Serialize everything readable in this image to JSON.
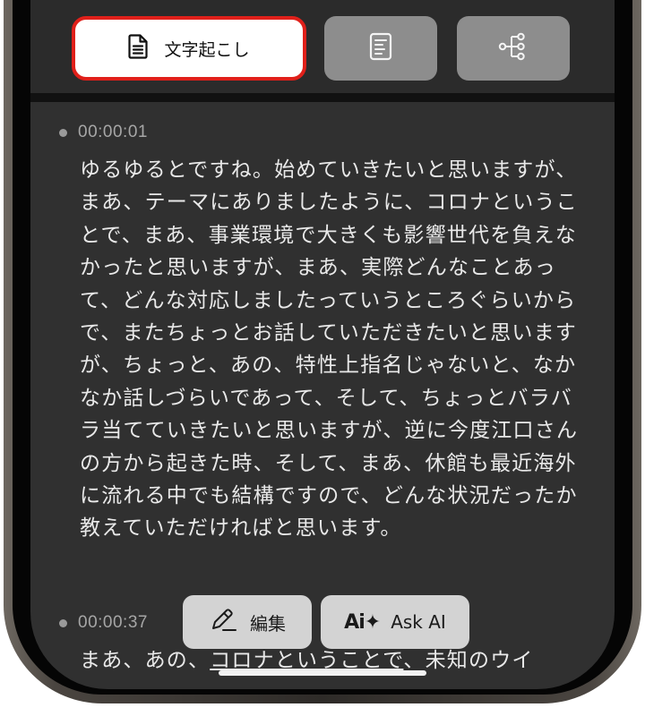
{
  "tabs": {
    "transcript_label": "文字起こし",
    "summary_icon": "document-lines-icon",
    "mindmap_icon": "tree-branch-icon",
    "active_border_color": "#e0201a"
  },
  "segments": [
    {
      "timestamp": "00:00:01",
      "text": "ゆるゆるとですね。始めていきたいと思いますが、まあ、テーマにありましたように、コロナということで、まあ、事業環境で大きくも影響世代を負えなかったと思いますが、まあ、実際どんなことあって、どんな対応しましたっていうところぐらいからで、またちょっとお話していただきたいと思いますが、ちょっと、あの、特性上指名じゃないと、なかなか話しづらいであって、そして、ちょっとバラバラ当てていきたいと思いますが、逆に今度江口さんの方から起きた時、そして、まあ、休館も最近海外に流れる中でも結構ですので、どんな状況だったか教えていただければと思います。"
    },
    {
      "timestamp": "00:00:37",
      "text_prefix": "まあ、あの、",
      "text_underlined": "コロナということで",
      "text_suffix": "、未知のウイ"
    }
  ],
  "actions": {
    "edit_label": "編集",
    "askai_logo": "Ai✦",
    "askai_label": "Ask AI"
  }
}
